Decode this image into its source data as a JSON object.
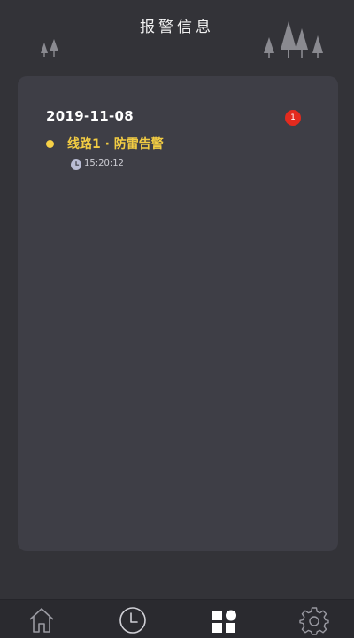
{
  "header": {
    "title": "报警信息"
  },
  "card": {
    "date": "2019-11-08",
    "badge_count": "1",
    "alarms": [
      {
        "title": "线路1 · 防雷告警",
        "time": "15:20:12",
        "status_color": "#f7d147"
      }
    ]
  },
  "bottom_nav": {
    "items": [
      {
        "icon": "home-icon",
        "active": false
      },
      {
        "icon": "history-icon",
        "active": false
      },
      {
        "icon": "alarm-info-icon",
        "active": true
      },
      {
        "icon": "settings-icon",
        "active": false
      }
    ]
  },
  "colors": {
    "background": "#333338",
    "card": "#3e3e46",
    "accent_yellow": "#f2cc43",
    "badge_red": "#e32a1e",
    "nav_bar": "#2a2a2f"
  }
}
